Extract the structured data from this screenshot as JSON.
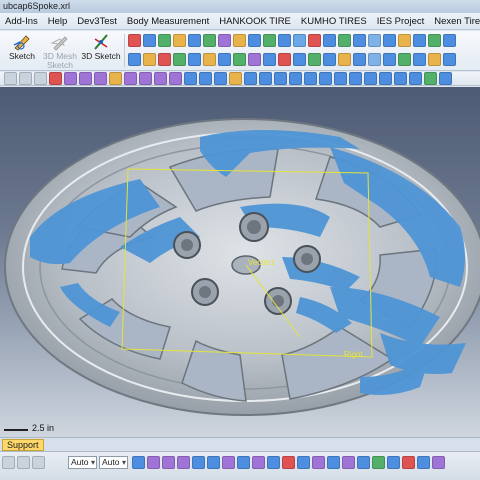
{
  "window": {
    "title": "ubcap6Spoke.xrl"
  },
  "menu": [
    "Add-Ins",
    "Help",
    "Dev3Test",
    "Body Measurement",
    "HANKOOK TIRE",
    "KUMHO TIRES",
    "IES Project",
    "Nexen Tire"
  ],
  "ribbon": {
    "sketch_label": "Sketch",
    "mesh_sketch_line1": "3D Mesh",
    "mesh_sketch_line2": "Sketch",
    "sketch3d_label": "3D Sketch"
  },
  "viewport": {
    "label_vector": "Vector1",
    "label_right": "Right",
    "scale_text": "2.5 in",
    "colors": {
      "background_top": "#4e5b74",
      "scan_blue": "#4f95d6",
      "metal": "#bfc5cc",
      "bounding_box": "#e4e33a"
    }
  },
  "panel": {
    "tab_support": "Support"
  },
  "statusbar": {
    "select1": "Auto",
    "select2": "Auto"
  },
  "icons": [
    "sketch-icon",
    "mesh-sketch-icon",
    "3d-sketch-icon",
    "view-cube-icon",
    "render-mode-icon"
  ]
}
